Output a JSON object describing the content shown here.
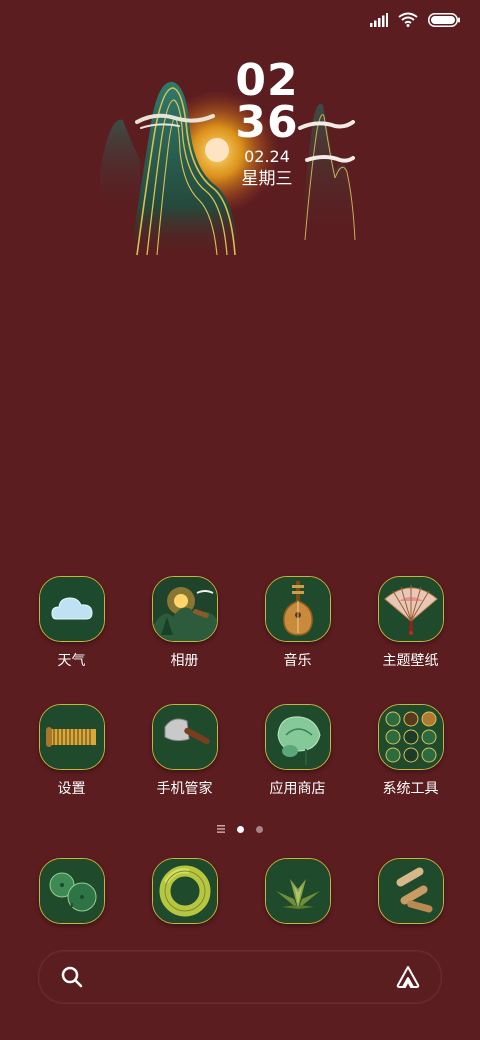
{
  "status_bar": {
    "signal_icon": "signal-icon",
    "wifi_icon": "wifi-icon",
    "battery_icon": "battery-icon",
    "battery_level": 1.0
  },
  "clock": {
    "hour": "02",
    "minute": "36",
    "date": "02.24",
    "weekday": "星期三"
  },
  "apps": [
    {
      "label": "天气",
      "icon": "weather-icon"
    },
    {
      "label": "相册",
      "icon": "gallery-icon"
    },
    {
      "label": "音乐",
      "icon": "music-icon"
    },
    {
      "label": "主题壁纸",
      "icon": "themes-icon"
    },
    {
      "label": "设置",
      "icon": "settings-icon"
    },
    {
      "label": "手机管家",
      "icon": "security-icon"
    },
    {
      "label": "应用商店",
      "icon": "app-store-icon"
    },
    {
      "label": "系统工具",
      "icon": "tools-folder-icon"
    }
  ],
  "page_indicator": {
    "pages": 2,
    "current": 1
  },
  "dock": [
    {
      "icon": "lotus-leaf-app-icon"
    },
    {
      "icon": "jade-ring-app-icon"
    },
    {
      "icon": "succulent-app-icon"
    },
    {
      "icon": "scroll-app-icon"
    }
  ],
  "search": {
    "search_icon": "search-icon",
    "assistant_icon": "assistant-icon"
  },
  "colors": {
    "background": "#5b1d20",
    "icon_border": "#c7b43b",
    "icon_bg": "#1f3a26"
  }
}
